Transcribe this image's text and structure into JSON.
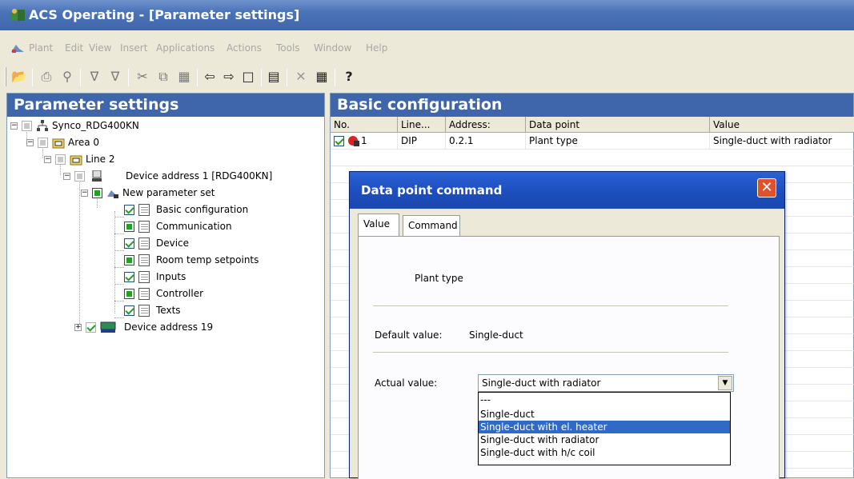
{
  "window": {
    "title": "ACS Operating - [Parameter settings]"
  },
  "menu": [
    "Plant",
    "Edit",
    "View",
    "Insert",
    "Applications",
    "Actions",
    "Tools",
    "Window",
    "Help"
  ],
  "left_pane": {
    "title": "Parameter settings",
    "tree": [
      {
        "label": "Synco_RDG400KN"
      },
      {
        "label": "Area 0"
      },
      {
        "label": "Line 2"
      },
      {
        "label": "Device address 1 [RDG400KN]"
      },
      {
        "label": "New parameter set"
      },
      {
        "label": "Basic configuration"
      },
      {
        "label": "Communication"
      },
      {
        "label": "Device"
      },
      {
        "label": "Room temp setpoints"
      },
      {
        "label": "Inputs"
      },
      {
        "label": "Controller"
      },
      {
        "label": "Texts"
      },
      {
        "label": "Device address 19"
      }
    ]
  },
  "right_pane": {
    "title": "Basic configuration",
    "columns": [
      "No.",
      "Line...",
      "Address:",
      "Data point",
      "Value"
    ],
    "rows": [
      {
        "no": "1",
        "line": "DIP",
        "address": "0.2.1",
        "data_point": "Plant type",
        "value": "Single-duct with radiator"
      }
    ]
  },
  "dialog": {
    "title": "Data point command",
    "tabs": [
      "Value",
      "Command"
    ],
    "data_point_name": "Plant type",
    "default_label": "Default value:",
    "default_value": "Single-duct",
    "actual_label": "Actual value:",
    "actual_value": "Single-duct with radiator",
    "options": [
      "---",
      "Single-duct",
      "Single-duct with el. heater",
      "Single-duct with radiator",
      "Single-duct with h/c coil"
    ],
    "highlighted_option": "Single-duct with el. heater"
  },
  "colors": {
    "title_bar": "#3f66aa",
    "dialog_title": "#1d4fbf",
    "selection": "#316ac5",
    "check_green": "#21a121"
  }
}
